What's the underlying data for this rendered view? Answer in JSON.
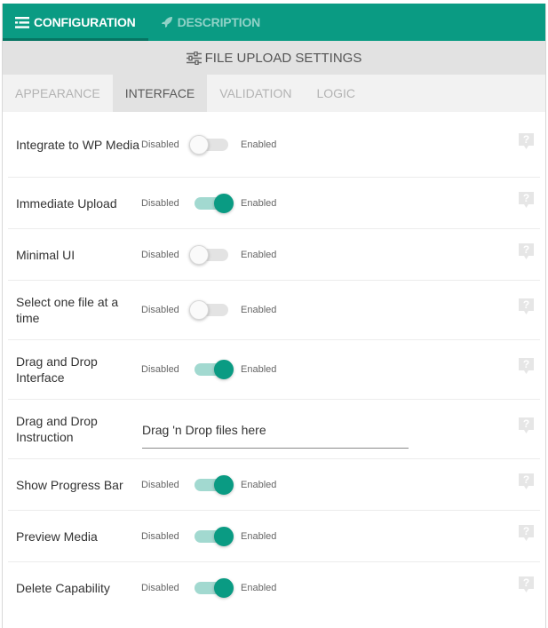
{
  "top_tabs": [
    {
      "label": "CONFIGURATION",
      "icon": "list-icon",
      "active": true
    },
    {
      "label": "DESCRIPTION",
      "icon": "rocket-icon",
      "active": false
    }
  ],
  "section": {
    "title": "FILE UPLOAD SETTINGS",
    "icon": "sliders-icon"
  },
  "sub_tabs": [
    {
      "label": "APPEARANCE",
      "active": false
    },
    {
      "label": "INTERFACE",
      "active": true
    },
    {
      "label": "VALIDATION",
      "active": false
    },
    {
      "label": "LOGIC",
      "active": false
    }
  ],
  "toggle_text": {
    "off": "Disabled",
    "on": "Enabled"
  },
  "settings": [
    {
      "label": "Integrate to WP Media",
      "type": "toggle",
      "enabled": false
    },
    {
      "label": "Immediate Upload",
      "type": "toggle",
      "enabled": true
    },
    {
      "label": "Minimal UI",
      "type": "toggle",
      "enabled": false
    },
    {
      "label": "Select one file at a time",
      "type": "toggle",
      "enabled": false
    },
    {
      "label": "Drag and Drop Interface",
      "type": "toggle",
      "enabled": true
    },
    {
      "label": "Drag and Drop Instruction",
      "type": "text",
      "value": "Drag 'n Drop files here"
    },
    {
      "label": "Show Progress Bar",
      "type": "toggle",
      "enabled": true
    },
    {
      "label": "Preview Media",
      "type": "toggle",
      "enabled": true
    },
    {
      "label": "Delete Capability",
      "type": "toggle",
      "enabled": true
    }
  ],
  "colors": {
    "accent": "#0a9b83",
    "accent_light": "#a2d9d0",
    "header_bg": "#e2e2e2",
    "subtab_bg": "#f2f2f2"
  }
}
